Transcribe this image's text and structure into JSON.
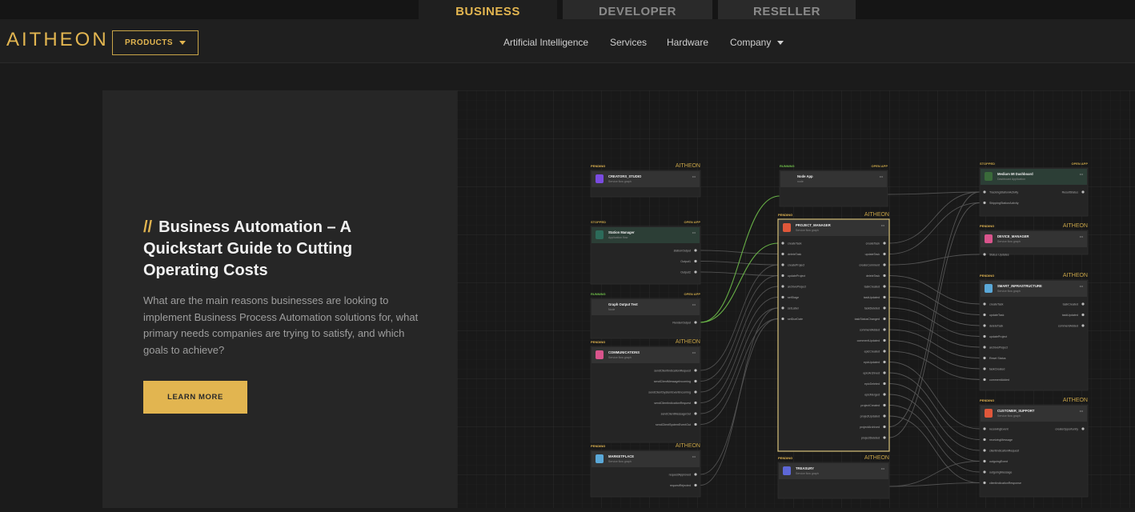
{
  "segments": [
    {
      "label": "BUSINESS",
      "active": true
    },
    {
      "label": "DEVELOPER",
      "active": false
    },
    {
      "label": "RESELLER",
      "active": false
    }
  ],
  "header": {
    "logo": "AITHEON",
    "products_label": "PRODUCTS",
    "nav": [
      "Artificial Intelligence",
      "Services",
      "Hardware",
      "Company"
    ]
  },
  "hero": {
    "slashes": "//",
    "title": "Business Automation – A Quickstart Guide to Cutting Operating Costs",
    "description": "What are the main reasons businesses are looking to implement Business Process Automation solutions for, what primary needs companies are trying to satisfy, and which goals to achieve?",
    "button": "LEARN MORE"
  },
  "graph_nodes": [
    {
      "id": "creators",
      "status": "PENDING",
      "brand": "AITHEON",
      "title": "CREATORS_STUDIO",
      "sub": "Service flow graph",
      "icon_color": "#7a4be0",
      "outputs": []
    },
    {
      "id": "station",
      "status": "STOPPED",
      "brand": "OPEN APP",
      "title": "Station Manager",
      "sub": "Application flow",
      "icon_color": "#2c6b5a",
      "outputs": [
        "stationOutput",
        "Output1",
        "Output2"
      ]
    },
    {
      "id": "graph_output",
      "status": "RUNNING",
      "brand": "OPEN APP",
      "title": "Graph Output Test",
      "sub": "Node",
      "icon_color": "",
      "outputs": [
        "RenderOutput"
      ]
    },
    {
      "id": "communications",
      "status": "PENDING",
      "brand": "AITHEON",
      "title": "COMMUNICATIONS",
      "sub": "Service flow graph",
      "icon_color": "#d9548c",
      "outputs": [
        "sendClientIndicationRequest",
        "sendClientMessageIncoming",
        "sendClientSystemEventIncoming",
        "sendClientIndicationRequest",
        "sendClientMessageOut",
        "sendClientSystemEventOut"
      ]
    },
    {
      "id": "marketplace",
      "status": "PENDING",
      "brand": "AITHEON",
      "title": "MARKETPLACE",
      "sub": "Service flow graph",
      "icon_color": "#5aa8d8",
      "outputs": [
        "requestApproved",
        "requestRejected"
      ]
    },
    {
      "id": "node_app",
      "status": "RUNNING",
      "brand": "OPEN APP",
      "title": "Node App",
      "sub": "node",
      "icon_color": "",
      "outputs": []
    },
    {
      "id": "project_manager",
      "status": "PENDING",
      "brand": "AITHEON",
      "title": "PROJECT_MANAGER",
      "sub": "Service flow graph",
      "icon_color": "#e0573a",
      "inputs": [
        "createTask",
        "deleteTask",
        "createProject",
        "updateProject",
        "archiveProject",
        "setStage",
        "setLabel",
        "setDueDate"
      ],
      "outputs": [
        "createTask",
        "updateTask",
        "createComment",
        "deleteTask",
        "taskCreated",
        "taskUpdated",
        "taskDeleted",
        "taskStatusChanged",
        "commentAdded",
        "commentUpdated",
        "epicCreated",
        "epicUpdated",
        "epicArchived",
        "epicDeleted",
        "epicMerged",
        "projectCreated",
        "projectUpdated",
        "projectArchived",
        "projectDeleted"
      ]
    },
    {
      "id": "treasury",
      "status": "PENDING",
      "brand": "AITHEON",
      "title": "TREASURY",
      "sub": "Service flow graph",
      "icon_color": "#5d67d6",
      "outputs": []
    },
    {
      "id": "medium_dashboard",
      "status": "STOPPED",
      "brand": "OPEN APP",
      "title": "Medium MI Dashboard",
      "sub": "Dashboard Application",
      "icon_color": "#3a6a3a",
      "inputs": [
        "TrackingStationActivity",
        "ShippingStationActivity"
      ],
      "outputs": [
        "ResultStatus"
      ]
    },
    {
      "id": "device_manager",
      "status": "PENDING",
      "brand": "AITHEON",
      "title": "DEVICE_MANAGER",
      "sub": "Service flow graph",
      "icon_color": "#d9548c",
      "inputs": [
        "Status Updates"
      ],
      "outputs": []
    },
    {
      "id": "smart_infra",
      "status": "PENDING",
      "brand": "AITHEON",
      "title": "SMART_INFRASTRUCTURE",
      "sub": "Service flow graph",
      "icon_color": "#5aa8d8",
      "inputs": [
        "createTask",
        "updateTask",
        "deleteTask",
        "updateProject",
        "archiveProject",
        "Reset Status",
        "taskCreated",
        "commentAdded"
      ],
      "outputs": [
        "taskCreated",
        "taskUpdated",
        "commentAdded"
      ]
    },
    {
      "id": "customer_support",
      "status": "PENDING",
      "brand": "AITHEON",
      "title": "CUSTOMER_SUPPORT",
      "sub": "Service flow graph",
      "icon_color": "#e0573a",
      "inputs": [
        "receivingEvent",
        "receivingMessage",
        "clientIndicationRequest",
        "outgoingEvent",
        "outgoingMessage",
        "clientIndicationResponse"
      ],
      "outputs": [
        "createOpportunity"
      ]
    }
  ]
}
